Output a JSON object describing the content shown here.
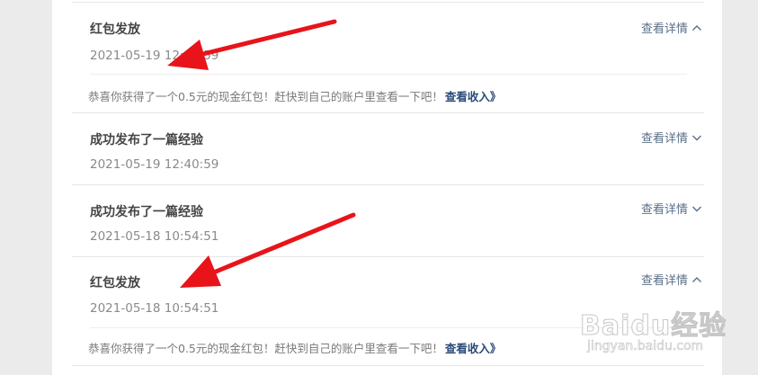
{
  "notifications": [
    {
      "title": "红包发放",
      "date": "2021-05-19 12:40:59",
      "detail_label": "查看详情",
      "expanded": true,
      "message": "恭喜你获得了一个0.5元的现金红包！赶快到自己的账户里查看一下吧！",
      "message_link": "查看收入》"
    },
    {
      "title": "成功发布了一篇经验",
      "date": "2021-05-19 12:40:59",
      "detail_label": "查看详情",
      "expanded": false
    },
    {
      "title": "成功发布了一篇经验",
      "date": "2021-05-18 10:54:51",
      "detail_label": "查看详情",
      "expanded": false
    },
    {
      "title": "红包发放",
      "date": "2021-05-18 10:54:51",
      "detail_label": "查看详情",
      "expanded": true,
      "message": "恭喜你获得了一个0.5元的现金红包！赶快到自己的账户里查看一下吧！",
      "message_link": "查看收入》"
    }
  ],
  "watermark": {
    "logo": "Baidu经验",
    "url": "jingyan.baidu.com"
  },
  "colors": {
    "annotation_arrow": "#e8141a",
    "link": "#2a4a7a",
    "detail_link": "#5a6f89"
  },
  "icons": {
    "expanded": "chevron-up-icon",
    "collapsed": "chevron-down-icon"
  }
}
